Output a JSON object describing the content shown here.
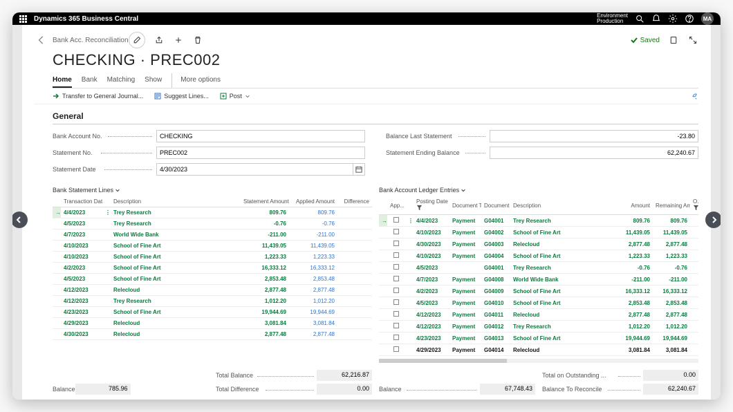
{
  "topbar": {
    "title": "Dynamics 365 Business Central",
    "env_label": "Environment",
    "env_name": "Production",
    "avatar": "MA"
  },
  "breadcrumb": "Bank Acc. Reconciliation",
  "page_title": "CHECKING · PREC002",
  "saved_label": "Saved",
  "tabs": {
    "home": "Home",
    "bank": "Bank",
    "matching": "Matching",
    "show": "Show",
    "more": "More options"
  },
  "actions": {
    "transfer": "Transfer to General Journal...",
    "suggest": "Suggest Lines...",
    "post": "Post"
  },
  "general": {
    "heading": "General",
    "bank_acct_label": "Bank Account No.",
    "bank_acct_value": "CHECKING",
    "stmt_no_label": "Statement No.",
    "stmt_no_value": "PREC002",
    "stmt_date_label": "Statement Date",
    "stmt_date_value": "4/30/2023",
    "bal_last_label": "Balance Last Statement",
    "bal_last_value": "-23.80",
    "end_bal_label": "Statement Ending Balance",
    "end_bal_value": "62,240.67"
  },
  "left_pane": {
    "title": "Bank Statement Lines",
    "cols": {
      "date": "Transaction Date",
      "desc": "Description",
      "stmt_amt": "Statement Amount",
      "applied": "Applied Amount",
      "diff": "Difference"
    },
    "rows": [
      {
        "date": "4/4/2023",
        "desc": "Trey Research",
        "stmt": "809.76",
        "applied": "809.76",
        "diff": "",
        "cls": "green",
        "sel": true
      },
      {
        "date": "4/5/2023",
        "desc": "Trey Research",
        "stmt": "-0.76",
        "applied": "-0.76",
        "diff": "",
        "cls": "green"
      },
      {
        "date": "4/7/2023",
        "desc": "World Wide Bank",
        "stmt": "-211.00",
        "applied": "-211.00",
        "diff": "",
        "cls": "green"
      },
      {
        "date": "4/10/2023",
        "desc": "School of Fine Art",
        "stmt": "11,439.05",
        "applied": "11,439.05",
        "diff": "",
        "cls": "green"
      },
      {
        "date": "4/10/2023",
        "desc": "School of Fine Art",
        "stmt": "1,223.33",
        "applied": "1,223.33",
        "diff": "",
        "cls": "green"
      },
      {
        "date": "4/2/2023",
        "desc": "School of Fine Art",
        "stmt": "16,333.12",
        "applied": "16,333.12",
        "diff": "",
        "cls": "green"
      },
      {
        "date": "4/5/2023",
        "desc": "School of Fine Art",
        "stmt": "2,853.48",
        "applied": "2,853.48",
        "diff": "",
        "cls": "green"
      },
      {
        "date": "4/12/2023",
        "desc": "Relecloud",
        "stmt": "2,877.48",
        "applied": "2,877.48",
        "diff": "",
        "cls": "green"
      },
      {
        "date": "4/12/2023",
        "desc": "Trey Research",
        "stmt": "1,012.20",
        "applied": "1,012.20",
        "diff": "",
        "cls": "green"
      },
      {
        "date": "4/23/2023",
        "desc": "School of Fine Art",
        "stmt": "19,944.69",
        "applied": "19,944.69",
        "diff": "",
        "cls": "green"
      },
      {
        "date": "4/29/2023",
        "desc": "Relecloud",
        "stmt": "3,081.84",
        "applied": "3,081.84",
        "diff": "",
        "cls": "green"
      },
      {
        "date": "4/30/2023",
        "desc": "Relecloud",
        "stmt": "2,877.48",
        "applied": "2,877.48",
        "diff": "",
        "cls": "green"
      }
    ]
  },
  "right_pane": {
    "title": "Bank Account Ledger Entries",
    "cols": {
      "app": "App...",
      "posting": "Posting Date",
      "type": "Document Type",
      "no": "Document No.",
      "desc": "Description",
      "amt": "Amount",
      "rem": "Remaining Amount",
      "op": "O..."
    },
    "rows": [
      {
        "date": "4/4/2023",
        "type": "Payment",
        "no": "G04001",
        "desc": "Trey Research",
        "amt": "809.76",
        "rem": "809.76",
        "cls": "green",
        "sel": true
      },
      {
        "date": "4/10/2023",
        "type": "Payment",
        "no": "G04002",
        "desc": "School of Fine Art",
        "amt": "11,439.05",
        "rem": "11,439.05",
        "cls": "green"
      },
      {
        "date": "4/30/2023",
        "type": "Payment",
        "no": "G04003",
        "desc": "Relecloud",
        "amt": "2,877.48",
        "rem": "2,877.48",
        "cls": "green"
      },
      {
        "date": "4/10/2023",
        "type": "Payment",
        "no": "G04004",
        "desc": "School of Fine Art",
        "amt": "1,223.33",
        "rem": "1,223.33",
        "cls": "green"
      },
      {
        "date": "4/5/2023",
        "type": "",
        "no": "G04001",
        "desc": "Trey Research",
        "amt": "-0.76",
        "rem": "-0.76",
        "cls": "green"
      },
      {
        "date": "4/7/2023",
        "type": "Payment",
        "no": "G04008",
        "desc": "World Wide Bank",
        "amt": "-211.00",
        "rem": "-211.00",
        "cls": "green"
      },
      {
        "date": "4/2/2023",
        "type": "Payment",
        "no": "G04009",
        "desc": "School of Fine Art",
        "amt": "16,333.12",
        "rem": "16,333.12",
        "cls": "green"
      },
      {
        "date": "4/5/2023",
        "type": "Payment",
        "no": "G04010",
        "desc": "School of Fine Art",
        "amt": "2,853.48",
        "rem": "2,853.48",
        "cls": "green"
      },
      {
        "date": "4/12/2023",
        "type": "Payment",
        "no": "G04011",
        "desc": "Relecloud",
        "amt": "2,877.48",
        "rem": "2,877.48",
        "cls": "green"
      },
      {
        "date": "4/12/2023",
        "type": "Payment",
        "no": "G04012",
        "desc": "Trey Research",
        "amt": "1,012.20",
        "rem": "1,012.20",
        "cls": "green"
      },
      {
        "date": "4/23/2023",
        "type": "Payment",
        "no": "G04013",
        "desc": "School of Fine Art",
        "amt": "19,944.69",
        "rem": "19,944.69",
        "cls": "green"
      },
      {
        "date": "4/29/2023",
        "type": "Payment",
        "no": "G04014",
        "desc": "Relecloud",
        "amt": "3,081.84",
        "rem": "3,081.84",
        "cls": "black"
      }
    ]
  },
  "totals": {
    "balance_label": "Balance",
    "balance_left": "785.96",
    "total_balance_label": "Total Balance",
    "total_balance": "62,216.87",
    "total_diff_label": "Total Difference",
    "total_diff": "0.00",
    "balance_right": "67,748.43",
    "outstanding_label": "Total on Outstanding ...",
    "outstanding": "0.00",
    "reconcile_label": "Balance To Reconcile",
    "reconcile": "62,240.67"
  }
}
